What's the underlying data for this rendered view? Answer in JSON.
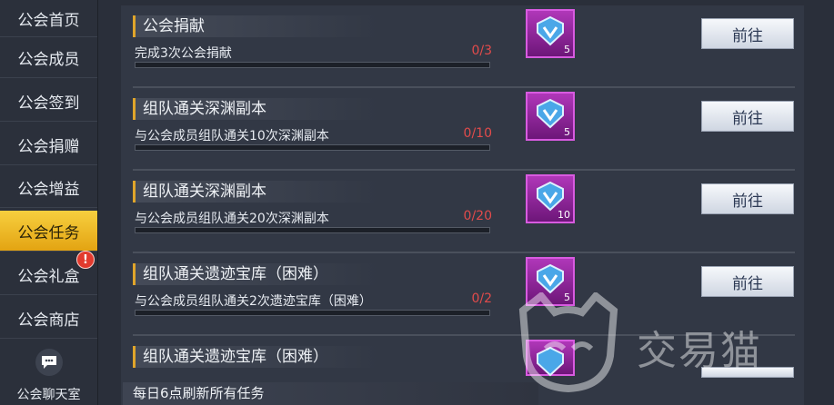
{
  "sidebar": {
    "items": [
      {
        "label": "公会首页"
      },
      {
        "label": "公会成员"
      },
      {
        "label": "公会签到"
      },
      {
        "label": "公会捐赠"
      },
      {
        "label": "公会增益"
      },
      {
        "label": "公会任务",
        "active": true
      },
      {
        "label": "公会礼盒",
        "badge": "!"
      },
      {
        "label": "公会商店"
      }
    ],
    "chat_label": "公会聊天室"
  },
  "tasks": [
    {
      "title": "公会捐献",
      "desc": "完成3次公会捐献",
      "progress": "0/3",
      "reward_qty": "5",
      "button": "前往"
    },
    {
      "title": "组队通关深渊副本",
      "desc": "与公会成员组队通关10次深渊副本",
      "progress": "0/10",
      "reward_qty": "5",
      "button": "前往"
    },
    {
      "title": "组队通关深渊副本",
      "desc": "与公会成员组队通关20次深渊副本",
      "progress": "0/20",
      "reward_qty": "10",
      "button": "前往"
    },
    {
      "title": "组队通关遗迹宝库（困难）",
      "desc": "与公会成员组队通关2次遗迹宝库（困难）",
      "progress": "0/2",
      "reward_qty": "5",
      "button": "前往"
    },
    {
      "title": "组队通关遗迹宝库（困难）"
    }
  ],
  "footer": {
    "text": "每日6点刷新所有任务"
  },
  "watermark": {
    "text": "交易猫"
  },
  "colors": {
    "accent": "#e0a52a",
    "active_tab": "#f0bb2a",
    "progress_text": "#e24b4b",
    "reward_bg": "#9a2aa6"
  }
}
